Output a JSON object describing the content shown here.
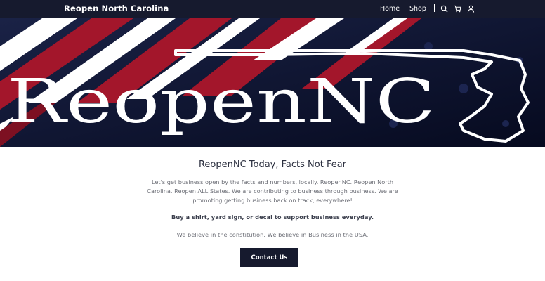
{
  "nav": {
    "brand": "Reopen North Carolina",
    "links": [
      {
        "label": "Home"
      },
      {
        "label": "Shop"
      }
    ],
    "icons": [
      "search-icon",
      "cart-icon",
      "user-icon"
    ]
  },
  "hero": {
    "title": "ReopenNC",
    "colors": {
      "navy": "#0b1230",
      "red": "#a3162b",
      "white": "#ffffff"
    }
  },
  "main": {
    "heading": "ReopenNC Today, Facts Not Fear",
    "intro": "Let's get business open by the facts and numbers, locally. ReopenNC. Reopen North Carolina. Reopen ALL States. We are contributing to business through business. We are promoting getting business back on track, everywhere!",
    "bold_line": "Buy a shirt, yard sign, or decal to support business everyday.",
    "belief": "We believe in the constitution. We believe in Business in the USA.",
    "cta_label": "Contact Us"
  }
}
